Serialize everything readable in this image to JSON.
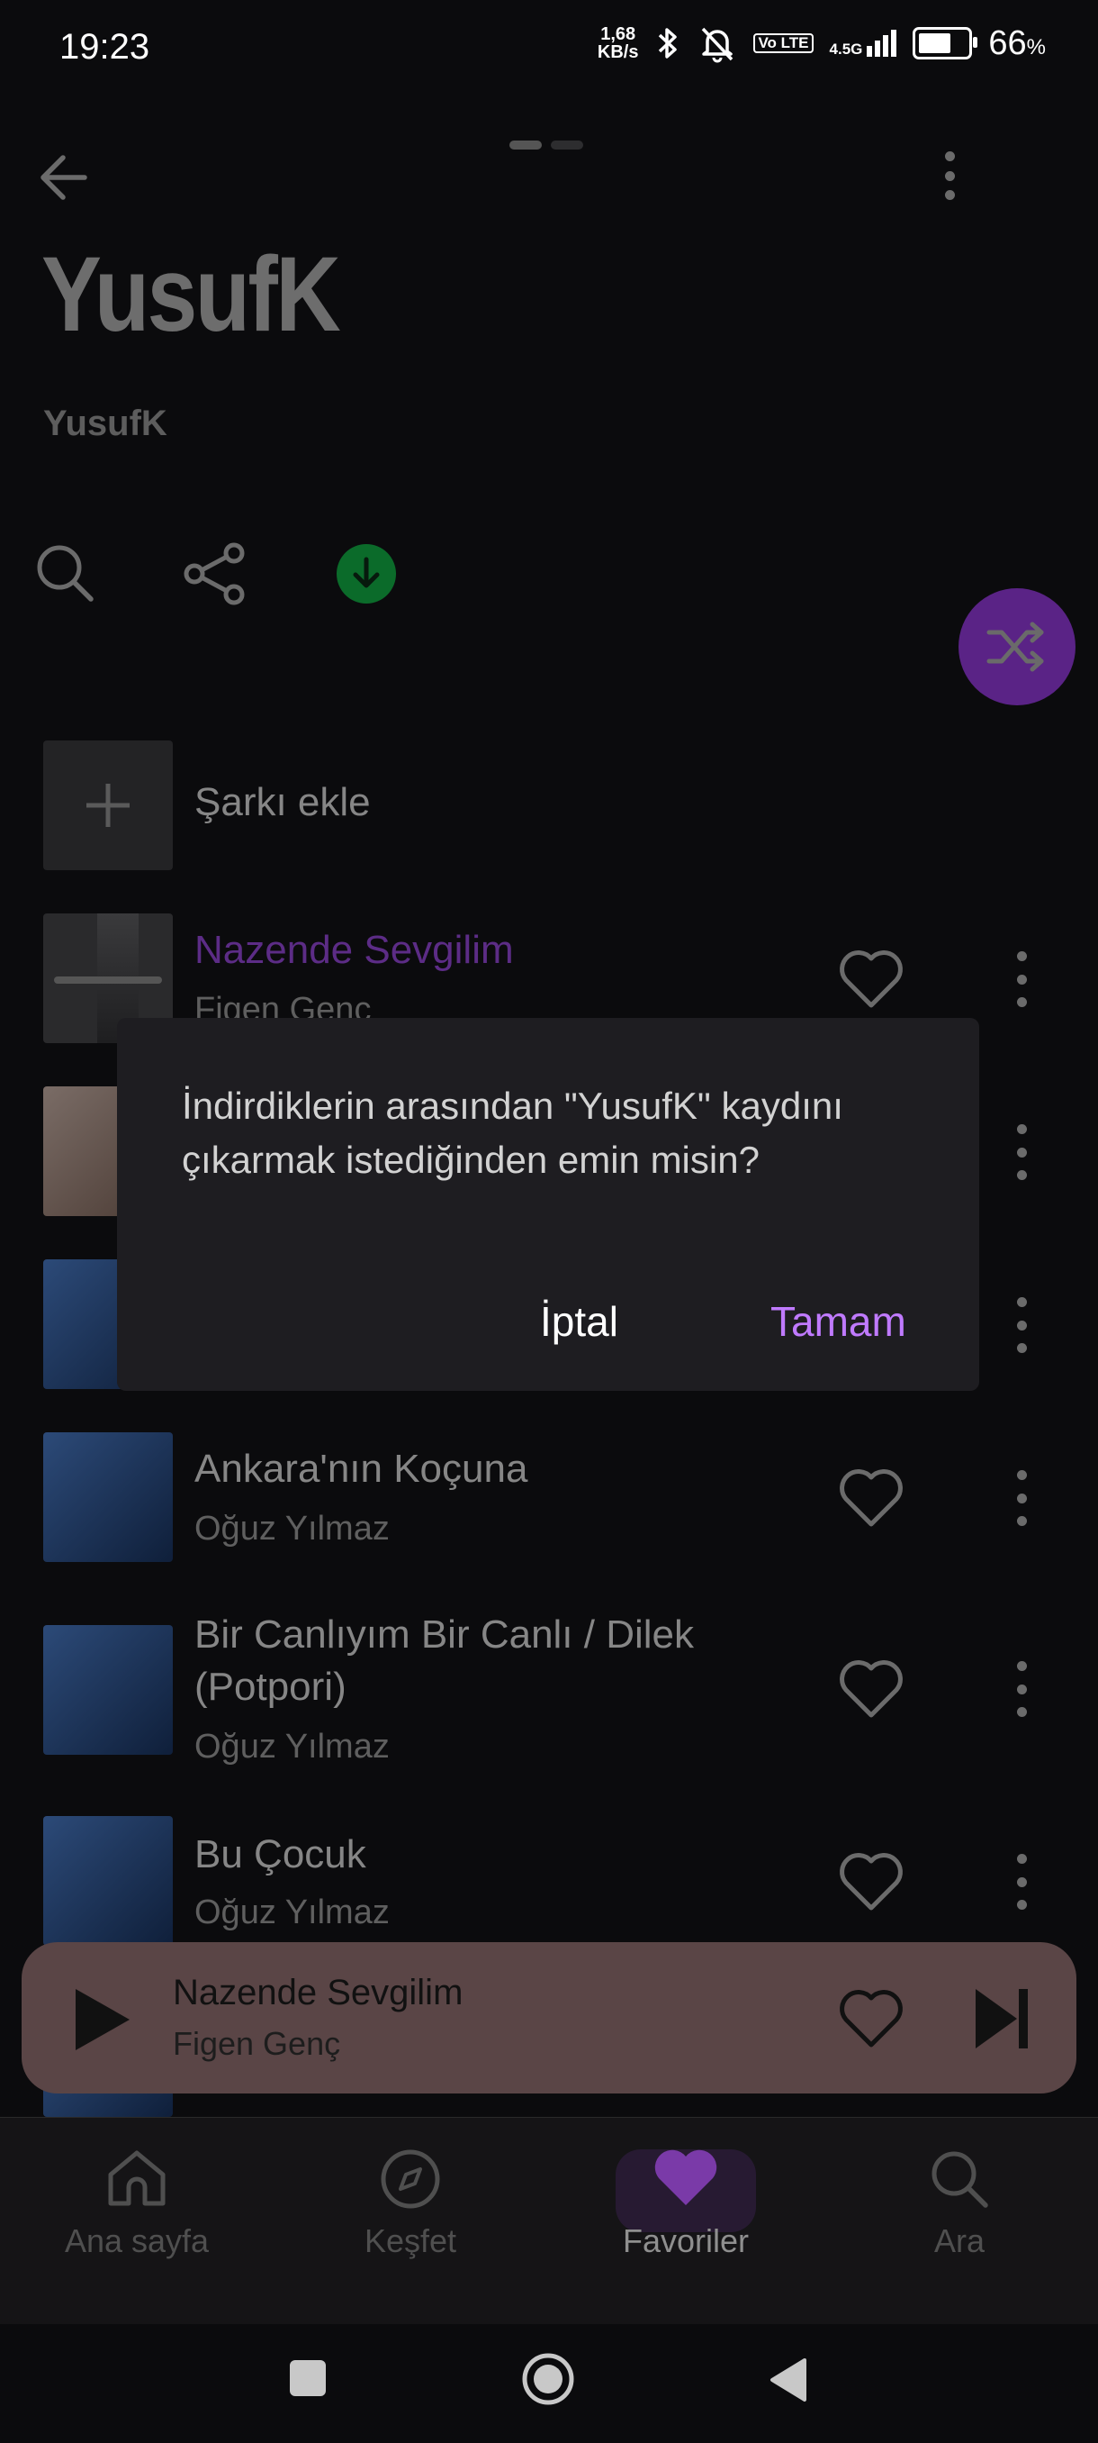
{
  "status_bar": {
    "time": "19:23",
    "net_speed_value": "1,68",
    "net_speed_unit": "KB/s",
    "lte_label": "Vo LTE",
    "network_type": "4.5G",
    "battery_percent": "66",
    "battery_symbol": "%",
    "battery_level": 0.66
  },
  "header": {
    "back_icon": "arrow-left-icon",
    "more_icon": "kebab-icon"
  },
  "playlist": {
    "title": "YusufK",
    "owner": "YusufK"
  },
  "actions": {
    "search_icon": "search-icon",
    "share_icon": "share-icon",
    "download_icon": "download-done-icon",
    "download_color": "#0b6b2a",
    "shuffle_icon": "shuffle-icon",
    "accent": "#5a2386"
  },
  "add_song": {
    "label": "Şarkı ekle"
  },
  "songs": [
    {
      "title": "Nazende Sevgilim",
      "artist": "Figen Genç",
      "active": true
    },
    {
      "title": "",
      "artist": ""
    },
    {
      "title": "",
      "artist": ""
    },
    {
      "title": "Ankara'nın Koçuna",
      "artist": "Oğuz Yılmaz"
    },
    {
      "title": "Bir Canlıyım Bir Canlı / Dilek",
      "title2": "(Potpori)",
      "artist": "Oğuz Yılmaz"
    },
    {
      "title": "Bu Çocuk",
      "artist": "Oğuz Yılmaz"
    }
  ],
  "mini_player": {
    "title": "Nazende Sevgilim",
    "artist": "Figen Genç"
  },
  "bottom_nav": [
    {
      "label": "Ana sayfa",
      "icon": "home-icon"
    },
    {
      "label": "Keşfet",
      "icon": "compass-icon"
    },
    {
      "label": "Favoriler",
      "icon": "heart-icon",
      "active": true
    },
    {
      "label": "Ara",
      "icon": "search-icon"
    }
  ],
  "dialog": {
    "line1": "İndirdiklerin arasından \"YusufK\" kaydını",
    "line2": "çıkarmak istediğinden emin misin?",
    "cancel": "İptal",
    "ok": "Tamam"
  }
}
